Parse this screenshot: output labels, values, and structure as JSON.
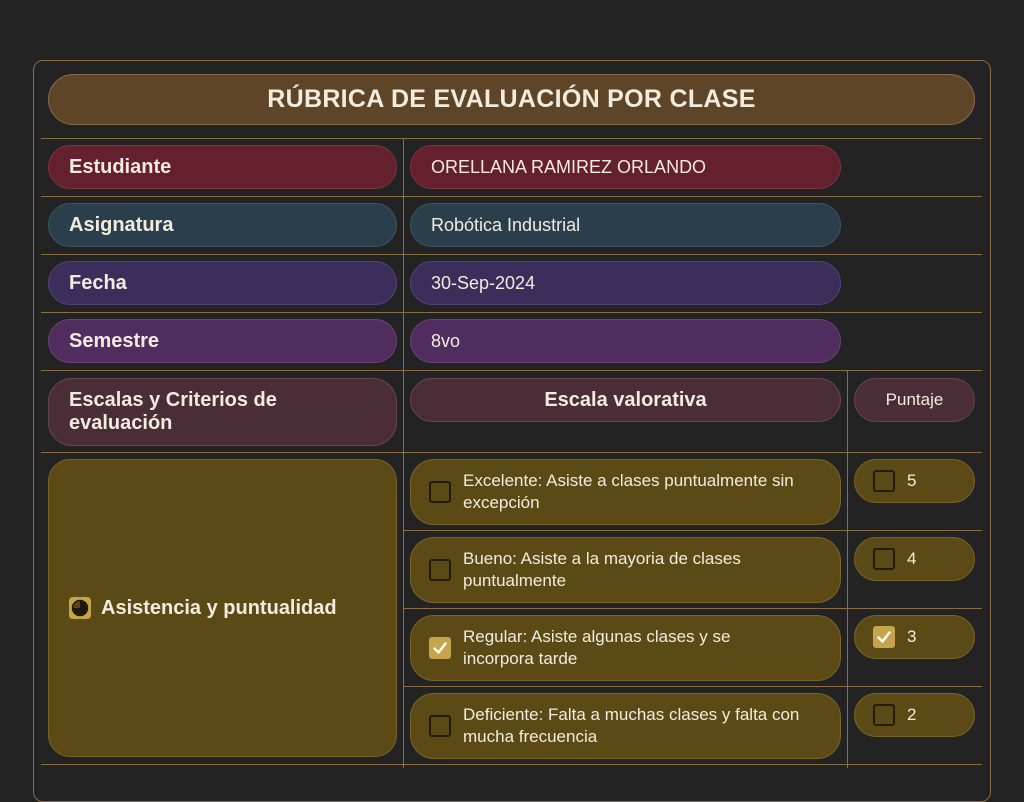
{
  "title": "RÚBRICA DE EVALUACIÓN POR CLASE",
  "info": [
    {
      "label": "Estudiante",
      "value": "ORELLANA RAMIREZ ORLANDO"
    },
    {
      "label": "Asignatura",
      "value": "Robótica Industrial"
    },
    {
      "label": "Fecha",
      "value": "30-Sep-2024"
    },
    {
      "label": "Semestre",
      "value": "8vo"
    }
  ],
  "headers": {
    "criteria": "Escalas y Criterios de evaluación",
    "scale": "Escala valorativa",
    "score": "Puntaje"
  },
  "criterion": {
    "icon": "pie-chart-icon",
    "label": "Asistencia y puntualidad",
    "options": [
      {
        "text": "Excelente: Asiste a clases puntualmente sin excepción",
        "score": "5",
        "checked": false
      },
      {
        "text": "Bueno: Asiste a la mayoria de clases puntualmente",
        "score": "4",
        "checked": false
      },
      {
        "text": "Regular: Asiste algunas clases y se incorpora tarde",
        "score": "3",
        "checked": true
      },
      {
        "text": "Deficiente: Falta a muchas clases y falta con mucha frecuencia",
        "score": "2",
        "checked": false
      }
    ]
  },
  "colors": {
    "accent_border": "#8a6d44",
    "title_bg": "#5e4528",
    "estudiante_bg": "#64202c",
    "asignatura_bg": "#2a3f4b",
    "fecha_bg": "#3c2d5b",
    "semestre_bg": "#512c5e",
    "header_bg": "#4a2d36",
    "criterion_bg": "#5b4a16",
    "checkbox_checked": "#c4a54c"
  }
}
